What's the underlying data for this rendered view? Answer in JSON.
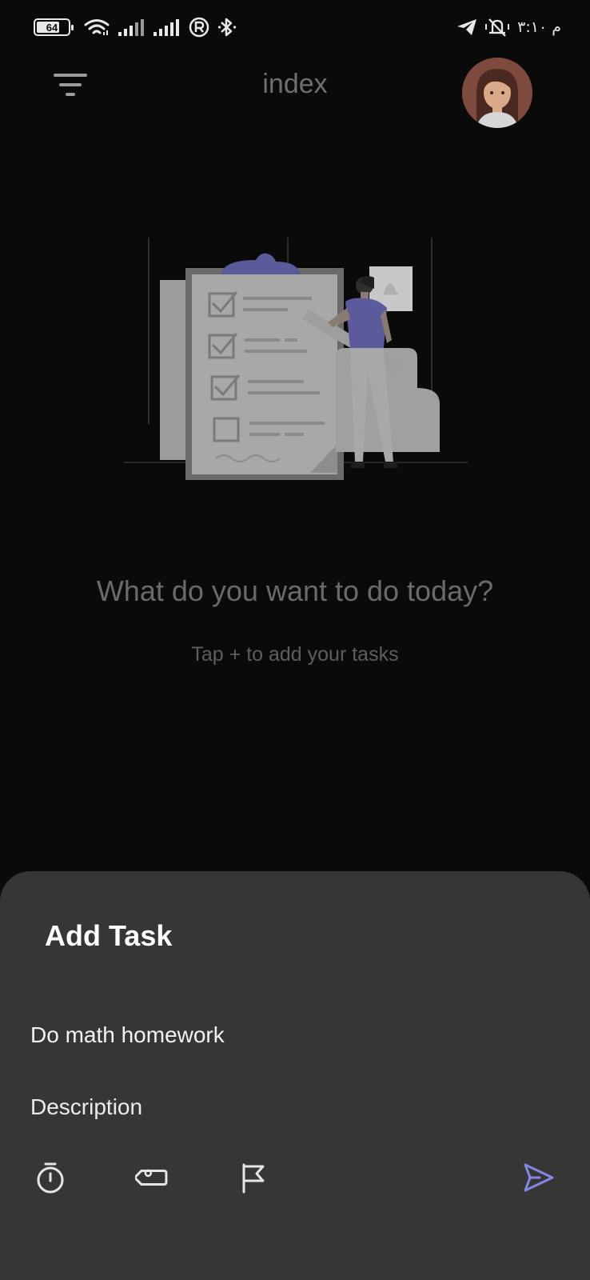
{
  "status_bar": {
    "battery_level": "64",
    "time": "۳:۱۰ م",
    "icons": [
      "battery-icon",
      "wifi-icon",
      "signal-icon",
      "signal-icon",
      "registered-icon",
      "bluetooth-icon",
      "telegram-icon",
      "vibrate-mute-icon"
    ]
  },
  "app_bar": {
    "title": "index",
    "filter_icon": "filter-icon",
    "avatar_icon": "avatar"
  },
  "empty_state": {
    "headline": "What do you want to do today?",
    "subline": "Tap + to add your tasks"
  },
  "add_task_sheet": {
    "title": "Add Task",
    "task_value": "Do math homework",
    "description_placeholder": "Description",
    "tools": [
      "timer-icon",
      "tag-icon",
      "flag-icon",
      "send-icon"
    ]
  },
  "colors": {
    "background": "#0a0a0b",
    "sheet": "#363637",
    "accent": "#8687e5",
    "muted_text": "#6a6a6a"
  }
}
